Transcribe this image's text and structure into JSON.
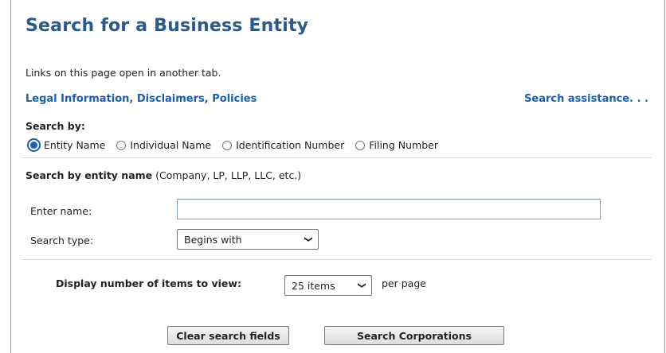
{
  "page": {
    "title": "Search for a Business Entity",
    "tab_note": "Links on this page open in another tab."
  },
  "links": {
    "legal": "Legal Information, Disclaimers, Policies",
    "assistance": "Search assistance. . ."
  },
  "search_by": {
    "label": "Search by:",
    "options": [
      {
        "label": "Entity Name",
        "selected": true
      },
      {
        "label": "Individual Name",
        "selected": false
      },
      {
        "label": "Identification Number",
        "selected": false
      },
      {
        "label": "Filing Number",
        "selected": false
      }
    ]
  },
  "entity_section": {
    "heading_bold": "Search by entity name",
    "heading_note": " (Company, LP, LLP, LLC, etc.)"
  },
  "fields": {
    "name_label": "Enter name:",
    "name_value": "",
    "type_label": "Search type:",
    "type_value": "Begins with"
  },
  "display": {
    "label": "Display number of items to view:",
    "items_value": "25 items",
    "suffix": "per page"
  },
  "buttons": {
    "clear": "Clear search fields",
    "search": "Search Corporations"
  },
  "colors": {
    "title": "#2a5a8a",
    "link": "#1a5fb4"
  }
}
